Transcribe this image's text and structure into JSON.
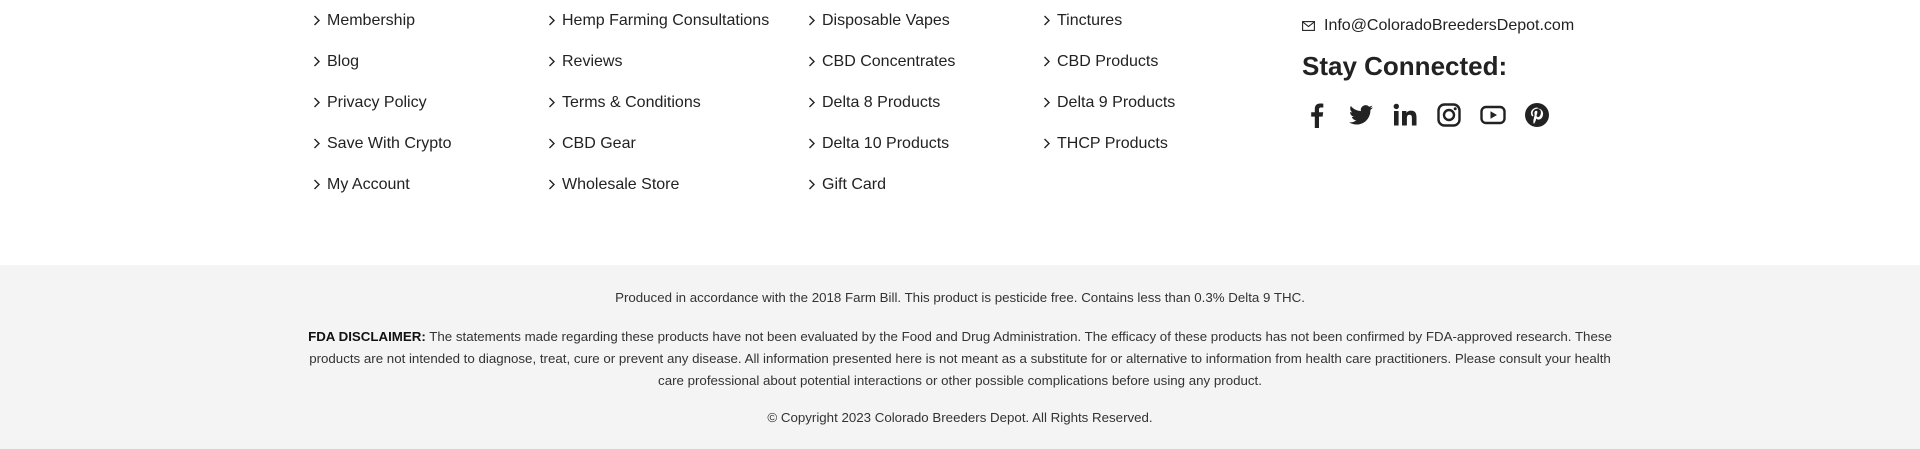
{
  "columns": [
    {
      "links": [
        "Membership",
        "Blog",
        "Privacy Policy",
        "Save With Crypto",
        "My Account"
      ]
    },
    {
      "links": [
        "Hemp Farming Consultations",
        "Reviews",
        "Terms & Conditions",
        "CBD Gear",
        "Wholesale Store"
      ]
    },
    {
      "links": [
        "Disposable Vapes",
        "CBD Concentrates",
        "Delta 8 Products",
        "Delta 10 Products",
        "Gift Card"
      ]
    },
    {
      "links": [
        "Tinctures",
        "CBD Products",
        "Delta 9 Products",
        "THCP Products"
      ]
    }
  ],
  "contact": {
    "email": "Info@ColoradoBreedersDepot.com",
    "stay_connected": "Stay Connected:",
    "social": [
      "facebook-icon",
      "twitter-icon",
      "linkedin-icon",
      "instagram-icon",
      "youtube-icon",
      "pinterest-icon"
    ]
  },
  "bottom": {
    "farm_bill": "Produced in accordance with the 2018 Farm Bill. This product is pesticide free. Contains less than 0.3% Delta 9 THC.",
    "fda_label": "FDA DISCLAIMER:",
    "fda_text": "The statements made regarding these products have not been evaluated by the Food and Drug Administration. The efficacy of these products has not been confirmed by FDA-approved research. These products are not intended to diagnose, treat, cure or prevent any disease. All information presented here is not meant as a substitute for or alternative to information from health care practitioners. Please consult your health care professional about potential interactions or other possible complications before using any product.",
    "copyright": "© Copyright 2023 Colorado Breeders Depot. All Rights Reserved."
  },
  "colors": {
    "text": "#222222",
    "bottom_bg": "#f4f4f4"
  }
}
